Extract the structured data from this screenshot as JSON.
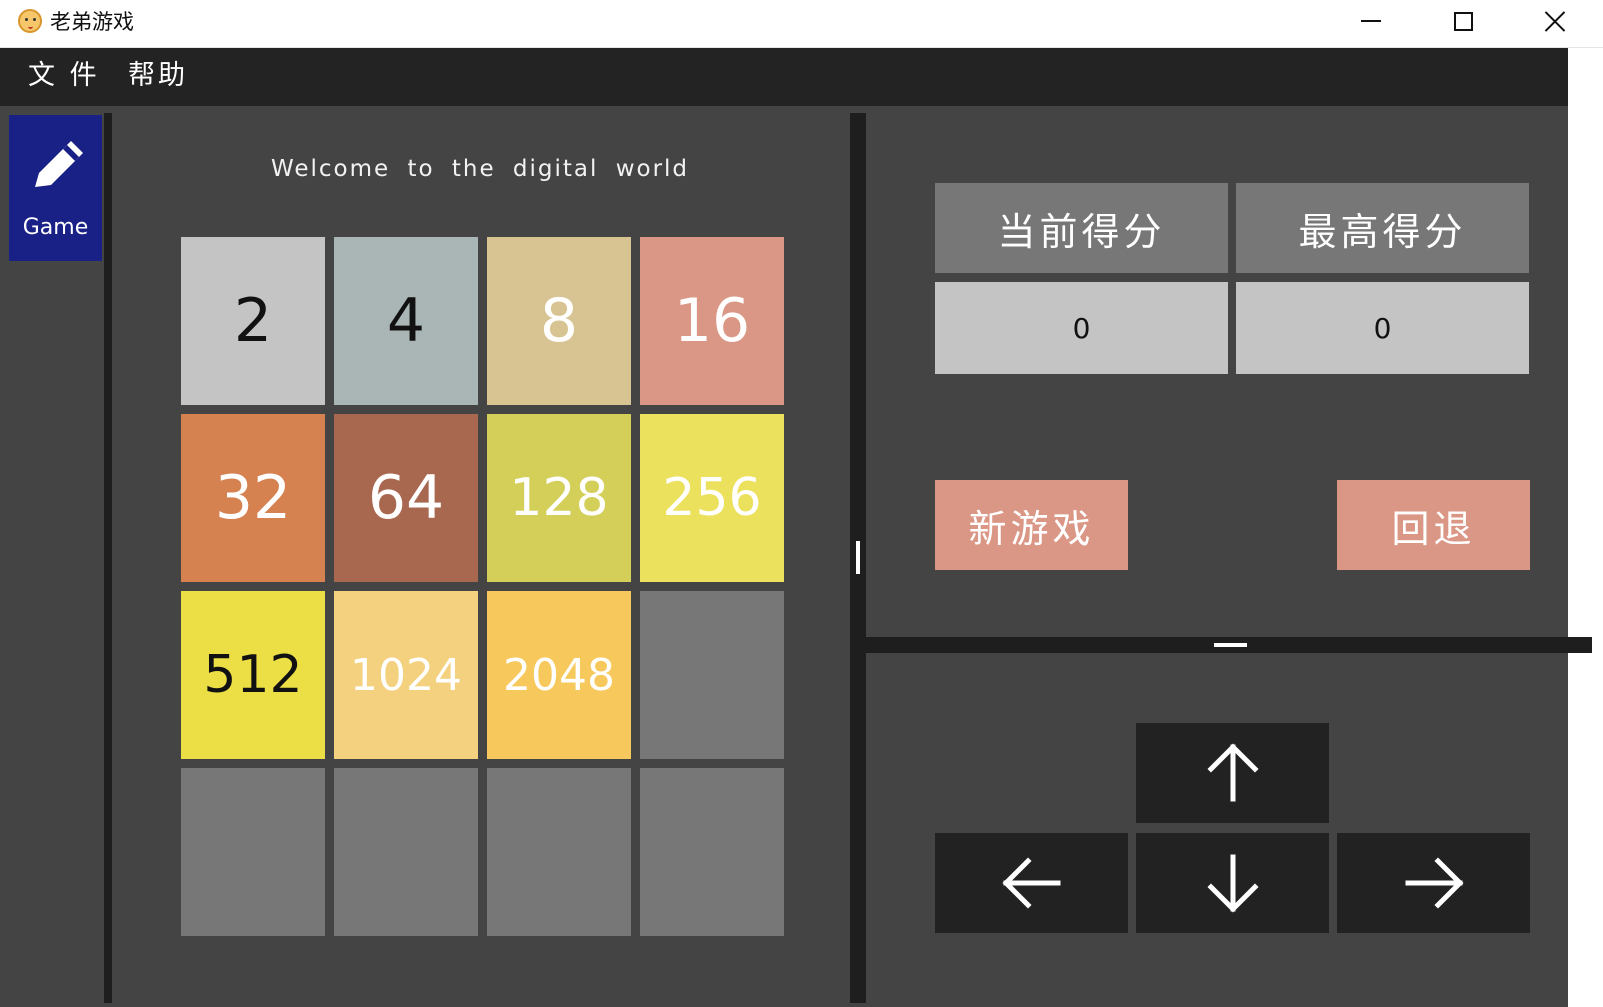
{
  "window": {
    "title": "老弟游戏",
    "icon": "app-face-icon",
    "controls": [
      "minimize",
      "maximize",
      "close"
    ]
  },
  "menu": {
    "file_label": "文 件",
    "help_label": "帮助"
  },
  "sidenav": {
    "icon": "pencil-icon",
    "label": "Game"
  },
  "game": {
    "welcome_text": "Welcome to the digital world",
    "tiles": [
      {
        "value": "2",
        "bg": "#c4c4c4",
        "fg": "#111111"
      },
      {
        "value": "4",
        "bg": "#aab5b5",
        "fg": "#111111"
      },
      {
        "value": "8",
        "bg": "#d8c393",
        "fg": "#ffffff"
      },
      {
        "value": "16",
        "bg": "#db9785",
        "fg": "#ffffff"
      },
      {
        "value": "32",
        "bg": "#d58150",
        "fg": "#ffffff"
      },
      {
        "value": "64",
        "bg": "#a86850",
        "fg": "#ffffff"
      },
      {
        "value": "128",
        "bg": "#d3cf58",
        "fg": "#ffffff"
      },
      {
        "value": "256",
        "bg": "#ece15c",
        "fg": "#ffffff"
      },
      {
        "value": "512",
        "bg": "#ecdf45",
        "fg": "#111111"
      },
      {
        "value": "1024",
        "bg": "#f3d17f",
        "fg": "#ffffff"
      },
      {
        "value": "2048",
        "bg": "#f7c95d",
        "fg": "#ffffff"
      },
      {
        "value": "",
        "bg": "#777777",
        "fg": "#ffffff"
      },
      {
        "value": "",
        "bg": "#777777",
        "fg": "#ffffff"
      },
      {
        "value": "",
        "bg": "#777777",
        "fg": "#ffffff"
      },
      {
        "value": "",
        "bg": "#777777",
        "fg": "#ffffff"
      },
      {
        "value": "",
        "bg": "#777777",
        "fg": "#ffffff"
      }
    ]
  },
  "scores": {
    "current_label": "当前得分",
    "best_label": "最高得分",
    "current_value": "0",
    "best_value": "0"
  },
  "actions": {
    "new_game_label": "新游戏",
    "undo_label": "回退"
  },
  "directions": {
    "up_icon": "arrow-up-icon",
    "down_icon": "arrow-down-icon",
    "left_icon": "arrow-left-icon",
    "right_icon": "arrow-right-icon"
  },
  "colors": {
    "background": "#444444",
    "menubar": "#232323",
    "sidenav": "#1a2186",
    "button_accent": "#db9785",
    "dir_button": "#222222",
    "score_head": "#777777",
    "score_value": "#c4c4c4"
  }
}
